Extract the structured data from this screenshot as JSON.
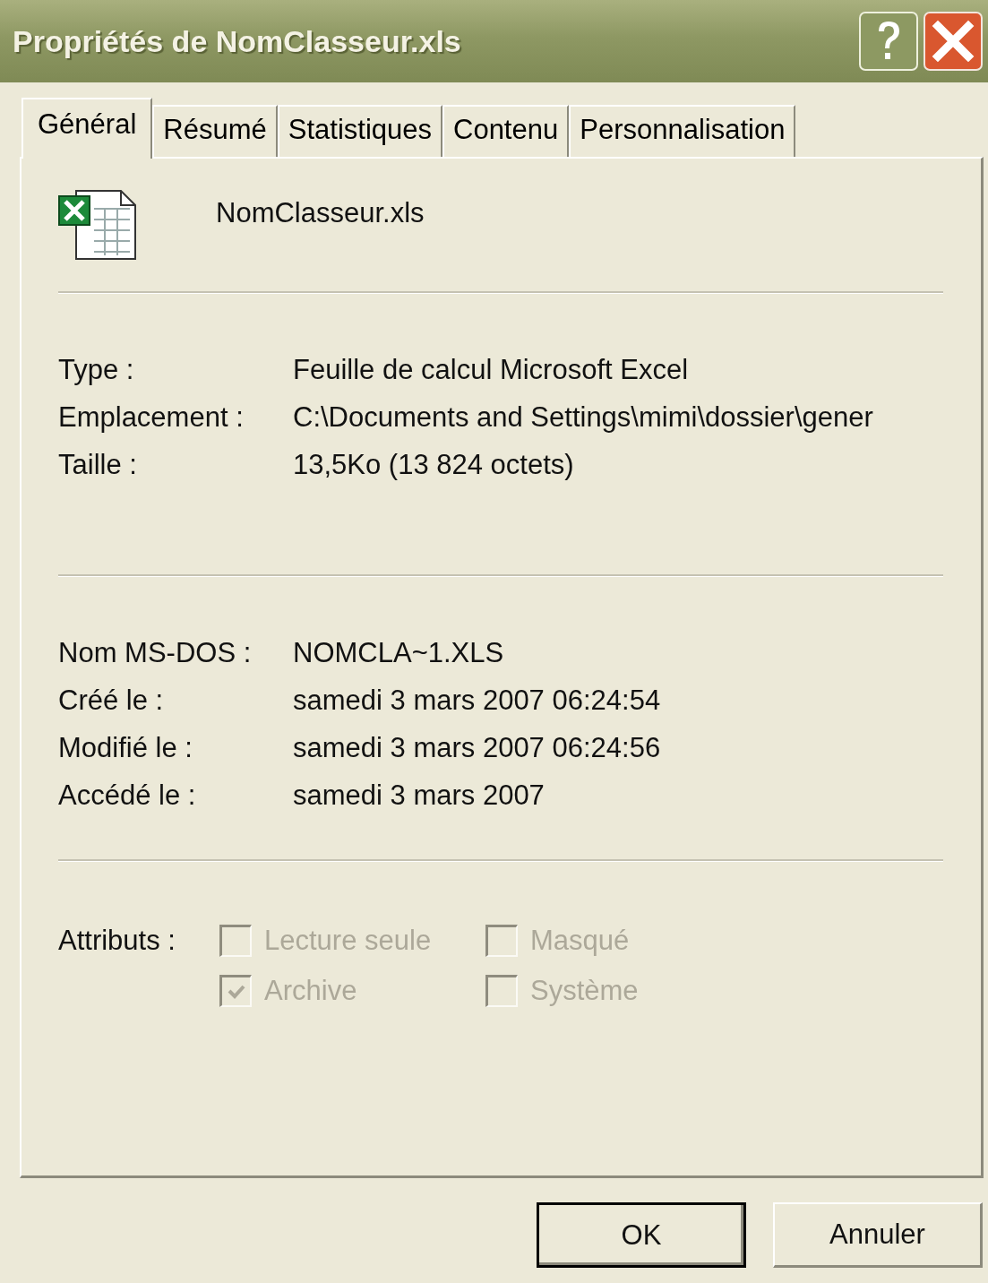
{
  "window": {
    "title": "Propriétés de NomClasseur.xls"
  },
  "tabs": [
    {
      "label": "Général",
      "selected": true
    },
    {
      "label": "Résumé",
      "selected": false
    },
    {
      "label": "Statistiques",
      "selected": false
    },
    {
      "label": "Contenu",
      "selected": false
    },
    {
      "label": "Personnalisation",
      "selected": false
    }
  ],
  "file_name": "NomClasseur.xls",
  "groups": [
    [
      {
        "label": "Type :",
        "value": "Feuille de calcul Microsoft Excel"
      },
      {
        "label": "Emplacement :",
        "value": "C:\\Documents and Settings\\mimi\\dossier\\gener"
      },
      {
        "label": "Taille :",
        "value": "13,5Ko (13 824 octets)"
      }
    ],
    [
      {
        "label": "Nom MS-DOS :",
        "value": "NOMCLA~1.XLS"
      },
      {
        "label": "Créé le :",
        "value": "samedi 3 mars 2007 06:24:54"
      },
      {
        "label": "Modifié le :",
        "value": "samedi 3 mars 2007 06:24:56"
      },
      {
        "label": "Accédé le :",
        "value": "samedi 3 mars 2007"
      }
    ]
  ],
  "attributes": {
    "label": "Attributs :",
    "items": [
      {
        "label": "Lecture seule",
        "checked": false,
        "disabled": true
      },
      {
        "label": "Masqué",
        "checked": false,
        "disabled": true
      },
      {
        "label": "Archive",
        "checked": true,
        "disabled": true
      },
      {
        "label": "Système",
        "checked": false,
        "disabled": true
      }
    ]
  },
  "buttons": [
    {
      "label": "OK",
      "default": true
    },
    {
      "label": "Annuler",
      "default": false
    }
  ]
}
